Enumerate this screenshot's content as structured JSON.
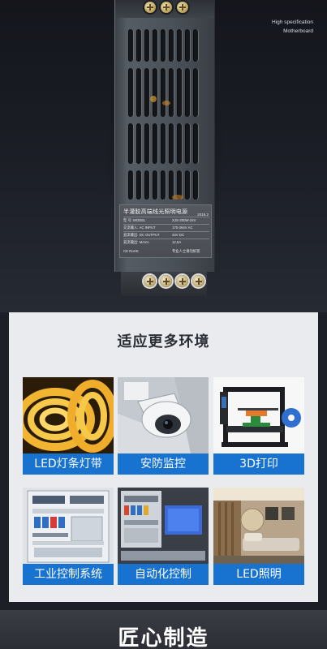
{
  "hero": {
    "tag_line1": "High specification",
    "tag_line2": "Motherboard"
  },
  "label_plate": {
    "title": "半灌胶高端线光照明电源",
    "date": "2019.2",
    "rows": [
      {
        "key": "型    号: MODEL",
        "value": "XJS-300W-24V"
      },
      {
        "key": "交流输入: AC INPUT",
        "value": "170-264V AC"
      },
      {
        "key": "直流输出: DC OUTPUT",
        "value": "24V DC"
      },
      {
        "key": "直流输出: MAXA",
        "value": "12.5A"
      }
    ],
    "footer_left": "CE  RoHS",
    "footer_right": "专业人士请勿拆装"
  },
  "applications": {
    "title": "适应更多环境",
    "items": [
      {
        "label": "LED灯条灯带",
        "icon": "led-strip"
      },
      {
        "label": "安防监控",
        "icon": "security-camera"
      },
      {
        "label": "3D打印",
        "icon": "3d-printer"
      },
      {
        "label": "工业控制系统",
        "icon": "control-cabinet"
      },
      {
        "label": "自动化控制",
        "icon": "automation"
      },
      {
        "label": "LED照明",
        "icon": "room-lighting"
      }
    ]
  },
  "banner": {
    "title": "匠心制造"
  }
}
